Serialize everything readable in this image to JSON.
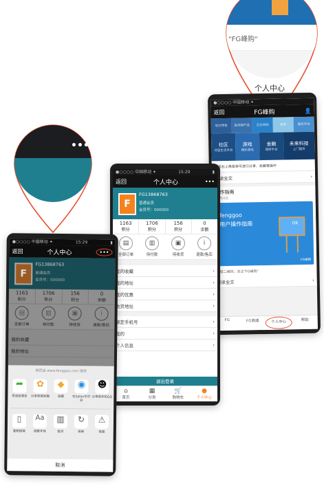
{
  "phone_left": {
    "status_left": "●○○○○ 中国移动 ✦",
    "status_time": "15:29",
    "back_label": "返回",
    "nav_title": "个人中心",
    "more_label": "•••",
    "profile_name": "FG13868763",
    "profile_level": "普通会员",
    "profile_id": "会员号：000000",
    "stats": [
      {
        "num": "1163",
        "label": "积分"
      },
      {
        "num": "1706",
        "label": "积分"
      },
      {
        "num": "156",
        "label": "积分"
      },
      {
        "num": "0",
        "label": "余额"
      }
    ],
    "actions": [
      "全部订单",
      "待付款",
      "待收货",
      "退款/售后"
    ],
    "list_items": [
      "我的收藏",
      "我的地址"
    ],
    "share_title": "网页由 www.fenggoo.com 提供",
    "share_row1": [
      "发送给朋友",
      "分享到朋友圈",
      "收藏",
      "在Safari中打开",
      "分享到手机QQ"
    ],
    "share_row2": [
      "复制链接",
      "调整字体",
      "投诉",
      "刷新",
      "举报"
    ],
    "cancel": "取消"
  },
  "phone_mid": {
    "status_left": "●○○○○ 中国移动 ✦",
    "status_time": "15:29",
    "back_label": "返回",
    "nav_title": "个人中心",
    "more_label": "•••",
    "profile_name": "FG13868763",
    "profile_level": "普通会员",
    "profile_id": "会员号：000000",
    "stats": [
      {
        "num": "1163",
        "label": "积分"
      },
      {
        "num": "1706",
        "label": "积分"
      },
      {
        "num": "156",
        "label": "积分"
      },
      {
        "num": "0",
        "label": "余额"
      }
    ],
    "actions": [
      "全部订单",
      "待付款",
      "待收货",
      "退款/售后"
    ],
    "list_items": [
      "我的收藏",
      "我的地址",
      "我的优惠",
      "收货地址",
      "绑定手机号",
      "我的",
      "个人信息"
    ],
    "logout": "退出登录",
    "tabs": [
      "首页",
      "分类",
      "购物车",
      "个人中心"
    ]
  },
  "phone_right": {
    "status_left": "●○○○○ 中国移动 ✦",
    "back_label": "返回",
    "nav_title": "FG峰购",
    "tiles_top": [
      "地方特色",
      "名优特产品",
      "企业采购",
      "商务",
      "服务平台"
    ],
    "tiles": [
      {
        "title": "社区",
        "sub": "邻里生活平台"
      },
      {
        "title": "游戏",
        "sub": "精彩游戏"
      },
      {
        "title": "金融",
        "sub": "理财平台"
      },
      {
        "title": "未来科技",
        "sub": "上门服务"
      }
    ],
    "line1": "点击右上角菜单可进行分享、收藏等操作",
    "line2": "阅读全文",
    "section_title": "操作指南",
    "section_date": "11月4日",
    "banner_title": "fenggoo",
    "banner_subtitle": "用户操作指南",
    "banner_ok": "OK",
    "banner_tag": "FG峰购",
    "line3": "扫描二维码，关注\"FG峰购\"",
    "line4": "阅读全文",
    "tabs": [
      "FG",
      "FG商城",
      "个人中心",
      "帮助"
    ]
  },
  "callout_top": {
    "text": "\"FG峰购\"",
    "caption": "个人中心"
  },
  "callout_left": {
    "dots": "•••"
  },
  "colors": {
    "teal": "#1f7f8f",
    "accent": "#e74c2c",
    "orange": "#f5821f",
    "dark": "#151515"
  }
}
